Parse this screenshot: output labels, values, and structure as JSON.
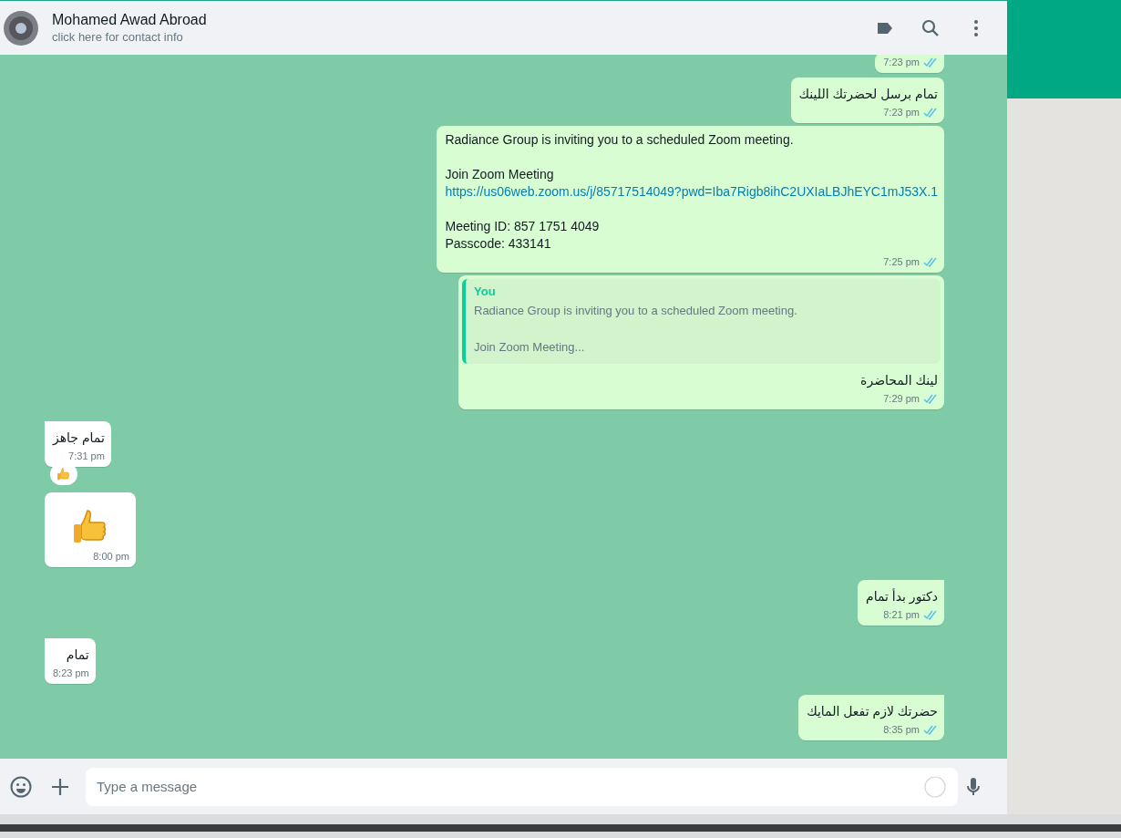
{
  "header": {
    "name": "Mohamed Awad Abroad",
    "subtitle": "click here for contact info"
  },
  "messages": [
    {
      "kind": "text",
      "outgoing": true,
      "time": "7:23 pm",
      "read": true
    },
    {
      "kind": "text",
      "outgoing": true,
      "text": "تمام برسل لحضرتك اللينك",
      "time": "7:23 pm",
      "read": true
    },
    {
      "kind": "invite",
      "outgoing": true,
      "parts": [
        {
          "kind": "text",
          "text": "Radiance Group is inviting you to a scheduled Zoom meeting."
        },
        {
          "kind": "gap"
        },
        {
          "kind": "text",
          "text": "Join Zoom Meeting"
        },
        {
          "kind": "link",
          "text": "https://us06web.zoom.us/j/85717514049?pwd=Iba7Rigb8ihC2UXIaLBJhEYC1mJ53X.1"
        },
        {
          "kind": "gap"
        },
        {
          "kind": "text",
          "text": "Meeting ID: 857 1751 4049"
        },
        {
          "kind": "text",
          "text": "Passcode: 433141"
        }
      ],
      "time": "7:25 pm",
      "read": true
    },
    {
      "kind": "reply",
      "outgoing": true,
      "quote": {
        "author": "You",
        "parts": [
          {
            "kind": "text",
            "text": "Radiance Group is inviting you to a scheduled Zoom meeting."
          },
          {
            "kind": "gap"
          },
          {
            "kind": "text",
            "text": "Join Zoom Meeting..."
          }
        ]
      },
      "text": "لينك المحاضرة",
      "time": "7:29 pm",
      "read": true
    },
    {
      "kind": "text",
      "outgoing": false,
      "text": "تمام جاهز",
      "time": "7:31 pm",
      "reacted": true
    },
    {
      "kind": "sticker",
      "outgoing": false,
      "time": "8:00 pm"
    },
    {
      "kind": "text",
      "outgoing": true,
      "text": "دكتور بدأ تمام",
      "time": "8:21 pm",
      "read": true
    },
    {
      "kind": "text",
      "outgoing": false,
      "text": "تمام",
      "time": "8:23 pm"
    },
    {
      "kind": "text",
      "outgoing": true,
      "text": "حضرتك لازم تفعل المايك",
      "time": "8:35 pm",
      "read": true
    }
  ],
  "composer": {
    "placeholder": "Type a message"
  }
}
